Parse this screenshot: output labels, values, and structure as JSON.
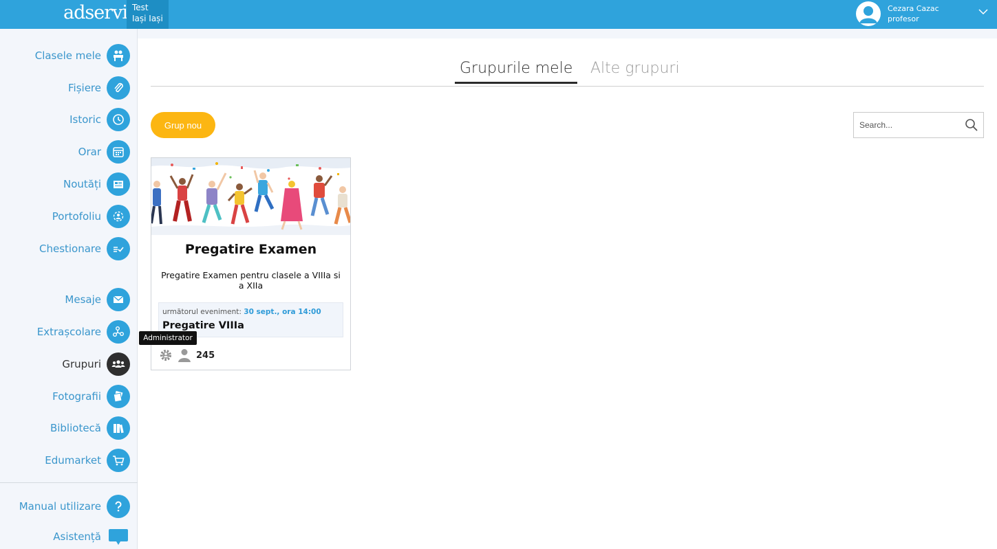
{
  "header": {
    "logo": "adservio",
    "school_line1": "Test",
    "school_line2": "Iași Iași",
    "user_name": "Cezara Cazac",
    "user_role": "profesor"
  },
  "sidebar": {
    "items": [
      {
        "label": "Clasele mele",
        "icon": "classroom-icon"
      },
      {
        "label": "Fișiere",
        "icon": "paperclip-icon"
      },
      {
        "label": "Istoric",
        "icon": "history-icon"
      },
      {
        "label": "Orar",
        "icon": "calendar-icon"
      },
      {
        "label": "Noutăți",
        "icon": "news-icon"
      },
      {
        "label": "Portofoliu",
        "icon": "portfolio-icon"
      },
      {
        "label": "Chestionare",
        "icon": "checklist-icon"
      },
      {
        "label": "Mesaje",
        "icon": "envelope-icon"
      },
      {
        "label": "Extrașcolare",
        "icon": "network-icon"
      },
      {
        "label": "Grupuri",
        "icon": "group-icon"
      },
      {
        "label": "Fotografii",
        "icon": "photos-icon"
      },
      {
        "label": "Bibliotecă",
        "icon": "books-icon"
      },
      {
        "label": "Edumarket",
        "icon": "cart-icon"
      },
      {
        "label": "Manual utilizare",
        "icon": "question-icon"
      },
      {
        "label": "Asistență",
        "icon": "chat-icon"
      }
    ],
    "active": "Grupuri"
  },
  "tabs": {
    "mine": "Grupurile mele",
    "others": "Alte grupuri"
  },
  "toolbar": {
    "new_group": "Grup nou",
    "search_placeholder": "Search..."
  },
  "group_card": {
    "title": "Pregatire Examen",
    "description": "Pregatire Examen pentru clasele a VIIIa si a XIIa",
    "next_event_prefix": "următorul eveniment:",
    "next_event_date": "30 sept., ora 14:00",
    "next_event_name": "Pregatire VIIIa",
    "members": "245",
    "tooltip": "Administrator"
  },
  "colors": {
    "accent": "#2fa3dc",
    "button": "#fcb612",
    "active_nav": "#2f2f2f"
  }
}
